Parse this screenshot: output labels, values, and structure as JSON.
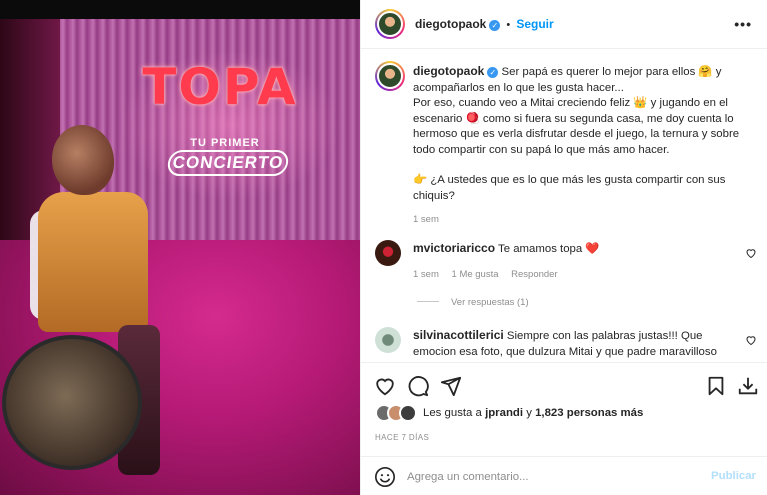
{
  "photo": {
    "logo_title": "TOPA",
    "logo_sub_top": "TU PRIMER",
    "logo_sub_bottom": "CONCIERTO"
  },
  "header": {
    "username": "diegotopaok",
    "separator": "•",
    "follow_label": "Seguir",
    "more_icon": "ellipsis-icon"
  },
  "caption": {
    "username": "diegotopaok",
    "line1": "Ser papá es querer lo mejor para ellos 🤗 y acompañarlos en lo que les gusta hacer...",
    "line2": "Por eso, cuando veo a Mitai creciendo feliz 👑 y jugando en el escenario 🪀 como si fuera su segunda casa, me doy cuenta lo hermoso que es verla disfrutar desde el juego, la ternura y sobre todo compartir con su papá lo que más amo hacer.",
    "line3": "👉 ¿A ustedes que es lo que más les gusta compartir con sus chiquis?",
    "time": "1 sem"
  },
  "comments": [
    {
      "username": "mvictoriaricco",
      "text": "Te amamos topa ❤️",
      "time": "1 sem",
      "likes": "1 Me gusta",
      "reply": "Responder"
    },
    {
      "username": "silvinacottilerici",
      "text": "Siempre con las palabras justas!!! Que emocion esa foto, que dulzura Mitai y que padre maravilloso"
    }
  ],
  "view_replies": "Ver respuestas (1)",
  "likes": {
    "prefix": "Les gusta a ",
    "user": "jprandi",
    "middle": " y ",
    "count": "1,823 personas más"
  },
  "date": "HACE 7 DÍAS",
  "add_comment": {
    "placeholder": "Agrega un comentario...",
    "publish_label": "Publicar"
  },
  "colors": {
    "accent": "#0095f6",
    "publish_disabled": "#b2dffc",
    "heart": "#ed4956",
    "muted": "#8e8e8e"
  }
}
